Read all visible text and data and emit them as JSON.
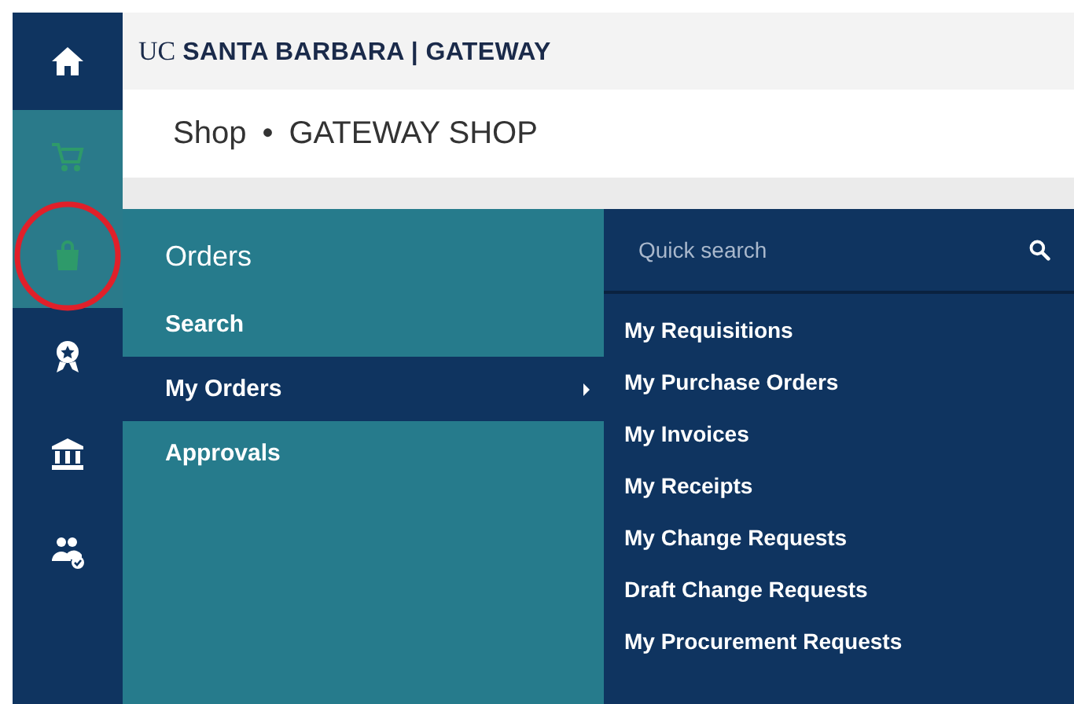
{
  "brand": {
    "prefix": "UC",
    "name": "SANTA BARBARA | GATEWAY"
  },
  "breadcrumb": {
    "items": [
      "Shop",
      "GATEWAY SHOP"
    ],
    "separator": "•"
  },
  "sidebar": {
    "items": [
      {
        "kind": "home",
        "selected": false
      },
      {
        "kind": "cart",
        "selected": true
      },
      {
        "kind": "orders",
        "selected": true,
        "circled": true
      },
      {
        "kind": "award",
        "selected": false
      },
      {
        "kind": "bank",
        "selected": false
      },
      {
        "kind": "people",
        "selected": false
      }
    ]
  },
  "orders_menu": {
    "title": "Orders",
    "items": [
      {
        "label": "Search",
        "selected": false,
        "has_submenu": false
      },
      {
        "label": "My Orders",
        "selected": true,
        "has_submenu": true
      },
      {
        "label": "Approvals",
        "selected": false,
        "has_submenu": false
      }
    ]
  },
  "submenu": {
    "search": {
      "placeholder": "Quick search"
    },
    "items": [
      "My Requisitions",
      "My Purchase Orders",
      "My Invoices",
      "My Receipts",
      "My Change Requests",
      "Draft Change Requests",
      "My Procurement Requests"
    ]
  }
}
